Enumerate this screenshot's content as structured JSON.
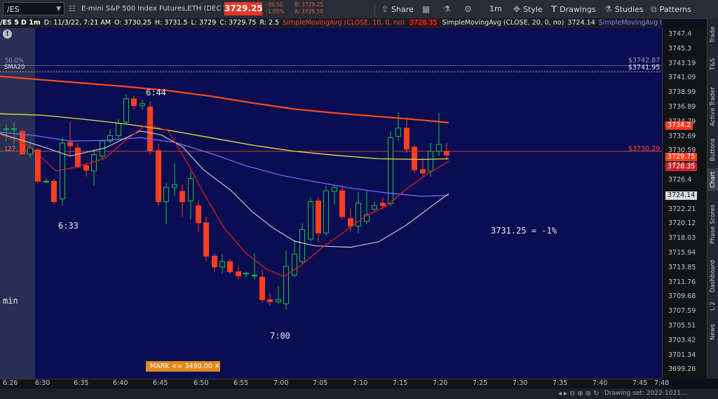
{
  "toolbar": {
    "symbol": "/ES",
    "instrument": "E-mini S&P 500 Index Futures,ETH (DEC 22)",
    "last_price": "3729.25",
    "net_change": "-39.50",
    "pct_change": "-1.05%",
    "bid": "B: 3729.25",
    "ask": "A: 3729.50",
    "share": "Share",
    "interval": "1m",
    "style": "Style",
    "drawings": "Drawings",
    "studies": "Studies",
    "patterns": "Patterns"
  },
  "study_bar": {
    "symbol_info": "/ES 5 D 1m",
    "date": "D: 11/3/22, 7:21 AM",
    "open": "O: 3730.25",
    "high": "H: 3731.5",
    "low": "L: 3729",
    "close": "C: 3729.75",
    "range": "R: 2.5",
    "sma10_label": "SimpleMovingAvg (CLOSE, 10, 0, no)",
    "sma10_value": "3728.35",
    "sma20_label": "SimpleMovingAvg (CLOSE, 20, 0, no)",
    "sma20_value": "3724.14",
    "sma50_label": "SimpleMovingAvg (CLOSE,..."
  },
  "price_axis": {
    "ticks": [
      "3747.4",
      "3745.3",
      "3743.19",
      "3741.09",
      "3738.99",
      "3736.89",
      "3734.79",
      "3732.69",
      "3730.59",
      "3728.48",
      "3726.4",
      "3724.3",
      "3722.21",
      "3720.12",
      "3718.03",
      "3715.94",
      "3713.85",
      "3711.76",
      "3709.68",
      "3707.59",
      "3705.51",
      "3703.42",
      "3701.34",
      "3699.26"
    ],
    "tags": {
      "t1": "$3742.87",
      "t2": "$3741.95",
      "t3": "3734.2",
      "t4": "$3730.29",
      "t5": "3729.75",
      "t6": "3728.35",
      "t7": "3724.14"
    }
  },
  "time_axis": [
    "6:26",
    "6:30",
    "6:35",
    "6:40",
    "6:45",
    "6:50",
    "6:55",
    "7:00",
    "7:05",
    "7:10",
    "7:15",
    "7:20",
    "7:25",
    "7:30",
    "7:35",
    "7:40",
    "7:45",
    "7:48"
  ],
  "annotations": {
    "t644": "6:44",
    "t633": "6:33",
    "t700": "7:00",
    "min": "min",
    "pct": "3731.25 = -1%",
    "fib": "50.0%",
    "sma20_tag": "SMA20",
    "left_127": "127."
  },
  "mark": "MARK <= 3490.00 ✕",
  "right_tabs": [
    "Trade",
    "T&S",
    "Active Trader",
    "Buttons",
    "Chart",
    "Phase Scores",
    "Dashboard",
    "L 2",
    "News"
  ],
  "status": {
    "drawing_sel": "Drawing set: 2022-1021..."
  },
  "colors": {
    "up": "#1fbf3b",
    "down": "#ff3d1f",
    "sma10": "#e02020",
    "sma20": "#c8c8d0",
    "sma50": "#6a6aff",
    "sma100": "#e8e43a",
    "sma200": "#ff4a1a"
  }
}
